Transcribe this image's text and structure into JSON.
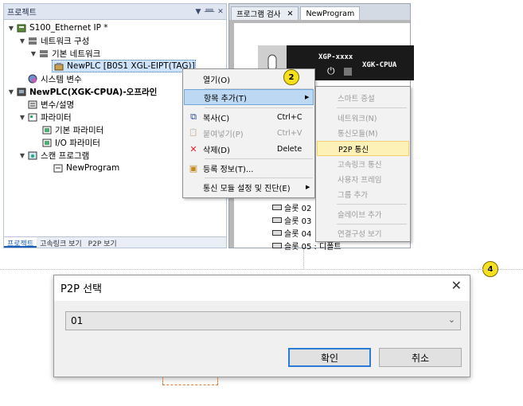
{
  "project_panel": {
    "title": "프로젝트",
    "toolbar": [
      "▼",
      "ᚊ",
      "✕"
    ],
    "tree": [
      {
        "label": "S100_Ethernet IP *",
        "level": 0,
        "exp": "▼"
      },
      {
        "label": "네트워크 구성",
        "level": 1,
        "exp": "▼"
      },
      {
        "label": "기본 네트워크",
        "level": 2,
        "exp": "▼"
      },
      {
        "label": "NewPLC [B0S1 XGL-EIPT(TAG)]",
        "level": 3,
        "exp": ""
      },
      {
        "label": "시스템 변수",
        "level": 1,
        "exp": ""
      },
      {
        "label": "NewPLC(XGK-CPUA)-오프라인",
        "level": 0,
        "exp": "▼"
      },
      {
        "label": "변수/설명",
        "level": 1,
        "exp": ""
      },
      {
        "label": "파라미터",
        "level": 1,
        "exp": "▼"
      },
      {
        "label": "기본 파라미터",
        "level": 2,
        "exp": ""
      },
      {
        "label": "I/O 파라미터",
        "level": 2,
        "exp": ""
      },
      {
        "label": "스캔 프로그램",
        "level": 1,
        "exp": "▼"
      },
      {
        "label": "NewProgram",
        "level": 2,
        "exp": ""
      }
    ],
    "tabs": [
      "프로젝트",
      "고속링크 보기",
      "P2P 보기"
    ]
  },
  "doc_area": {
    "tabs": [
      {
        "label": "프로그램 검사"
      },
      {
        "label": "NewProgram"
      }
    ],
    "plc_model": "XGP-xxxx",
    "cpu_model": "XGK-CPUA",
    "slots": [
      "슬롯 02",
      "슬롯 03",
      "슬롯 04",
      "슬롯 05 : 디폴트"
    ]
  },
  "context_menu": {
    "items": [
      {
        "icon": "",
        "label": "열기(O)",
        "shortcut": "",
        "arrow": ""
      },
      {
        "icon": "",
        "label": "항목 추가(T)",
        "shortcut": "",
        "arrow": "▶"
      },
      {
        "icon": "⧉",
        "label": "복사(C)",
        "shortcut": "Ctrl+C",
        "arrow": ""
      },
      {
        "icon": "📋",
        "label": "붙여넣기(P)",
        "shortcut": "Ctrl+V",
        "arrow": ""
      },
      {
        "icon": "✕",
        "label": "삭제(D)",
        "shortcut": "Delete",
        "arrow": ""
      },
      {
        "icon": "▣",
        "label": "등록 정보(T)...",
        "shortcut": "",
        "arrow": ""
      },
      {
        "icon": "",
        "label": "통신 모듈 설정 및 진단(E)",
        "shortcut": "",
        "arrow": "▶"
      }
    ]
  },
  "sub_menu": {
    "items": [
      {
        "label": "스마트 증설",
        "state": "disabled"
      },
      {
        "label": "네트워크(N)",
        "state": "disabled"
      },
      {
        "label": "통신모듈(M)",
        "state": "disabled"
      },
      {
        "label": "P2P 통신",
        "state": "highlighted"
      },
      {
        "label": "고속링크 통신",
        "state": "disabled"
      },
      {
        "label": "사용자 프레임",
        "state": "disabled"
      },
      {
        "label": "그룹 추가",
        "state": "disabled"
      },
      {
        "label": "슬레이브 추가",
        "state": "disabled"
      },
      {
        "label": "연결구성 보기",
        "state": "disabled"
      }
    ]
  },
  "badges": {
    "step2": "2",
    "step4": "4"
  },
  "dialog": {
    "title": "P2P 선택",
    "close": "✕",
    "selected_value": "01",
    "ok_label": "확인",
    "cancel_label": "취소"
  }
}
